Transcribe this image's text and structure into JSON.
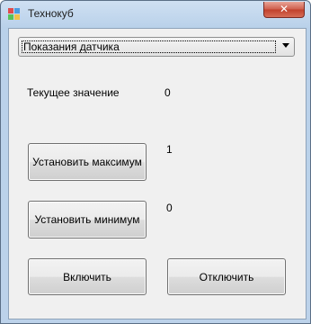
{
  "window": {
    "title": "Технокуб",
    "close_glyph": "✕"
  },
  "sensor_select": {
    "selected": "Показания датчика"
  },
  "current_value": {
    "label": "Текущее значение",
    "value": "0"
  },
  "max": {
    "button_label": "Установить максимум",
    "value": "1"
  },
  "min": {
    "button_label": "Установить минимум",
    "value": "0"
  },
  "actions": {
    "enable_label": "Включить",
    "disable_label": "Отключить"
  },
  "colors": {
    "titlebar": "#bcd2ea",
    "close": "#c0402c",
    "client_bg": "#f0f0f0"
  },
  "icons": {
    "app": "app-grid-icon",
    "dropdown": "chevron-down-icon"
  }
}
